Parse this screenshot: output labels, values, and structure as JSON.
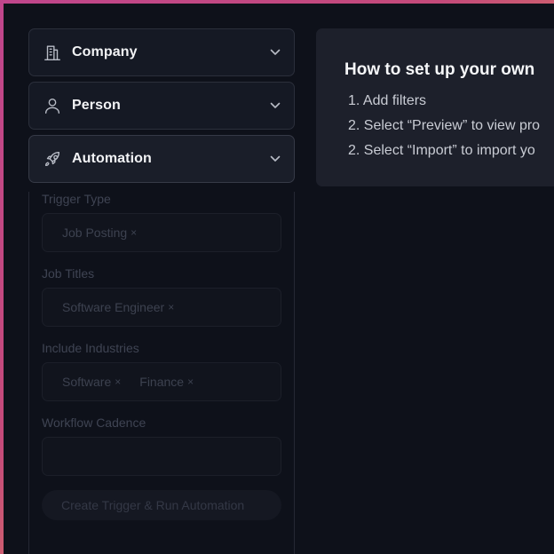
{
  "sidebar": {
    "sections": [
      {
        "label": "Company",
        "icon": "building-icon"
      },
      {
        "label": "Person",
        "icon": "user-icon"
      },
      {
        "label": "Automation",
        "icon": "rocket-icon"
      }
    ],
    "automation": {
      "trigger_type": {
        "label": "Trigger Type",
        "chips": [
          "Job Posting"
        ]
      },
      "job_titles": {
        "label": "Job Titles",
        "chips": [
          "Software Engineer"
        ]
      },
      "include_industries": {
        "label": "Include Industries",
        "chips": [
          "Software",
          "Finance"
        ]
      },
      "workflow_cadence": {
        "label": "Workflow Cadence",
        "value": ""
      },
      "cta_label": "Create Trigger & Run Automation"
    }
  },
  "instructions": {
    "title": "How to set up your own",
    "steps": [
      "1. Add filters",
      "2. Select “Preview” to view pro",
      "2. Select “Import” to import yo"
    ]
  },
  "chip_remove_glyph": "×",
  "colors": {
    "background": "#0e111a",
    "panel": "#151924",
    "card": "#1d202b",
    "frame_gradient": [
      "#c0468c",
      "#f0b060"
    ]
  }
}
